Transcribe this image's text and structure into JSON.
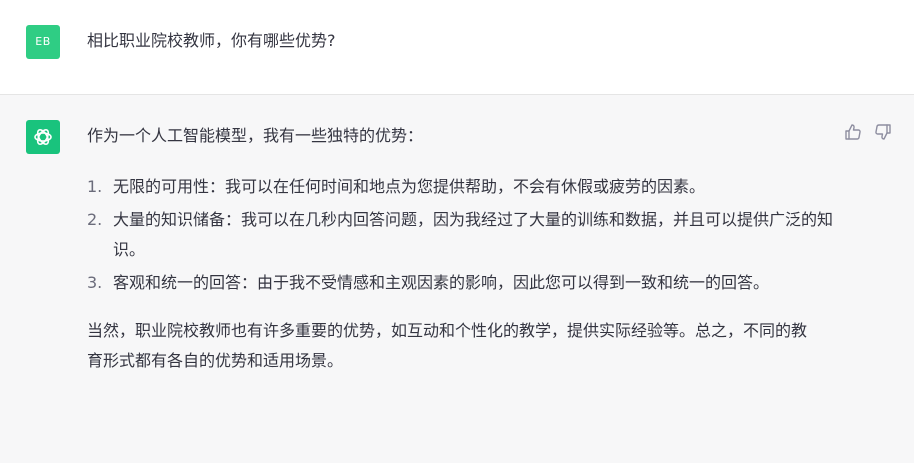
{
  "user_message": {
    "avatar_initials": "EB",
    "avatar_color": "#2fcd84",
    "text": "相比职业院校教师，你有哪些优势?"
  },
  "assistant_message": {
    "avatar_icon": "openai-logo-icon",
    "avatar_color": "#19c37d",
    "intro": "作为一个人工智能模型，我有一些独特的优势：",
    "points": [
      {
        "number": "1.",
        "text": "无限的可用性：我可以在任何时间和地点为您提供帮助，不会有休假或疲劳的因素。"
      },
      {
        "number": "2.",
        "text": "大量的知识储备：我可以在几秒内回答问题，因为我经过了大量的训练和数据，并且可以提供广泛的知识。"
      },
      {
        "number": "3.",
        "text": "客观和统一的回答：由于我不受情感和主观因素的影响，因此您可以得到一致和统一的回答。"
      }
    ],
    "closing": "当然，职业院校教师也有许多重要的优势，如互动和个性化的教学，提供实际经验等。总之，不同的教育形式都有各自的优势和适用场景。",
    "feedback_icons": [
      "thumbs-up-icon",
      "thumbs-down-icon"
    ]
  }
}
